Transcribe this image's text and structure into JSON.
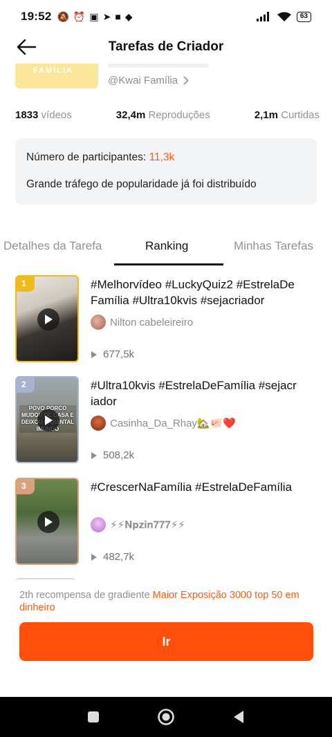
{
  "status_bar": {
    "time": "19:52",
    "battery": "63"
  },
  "header": {
    "title": "Tarefas de Criador"
  },
  "topic": {
    "thumb_text": "FAMÍLIA",
    "handle": "@Kwai Família"
  },
  "stats": {
    "videos_value": "1833",
    "videos_label": "vídeos",
    "plays_value": "32,4m",
    "plays_label": "Reproduções",
    "likes_value": "2,1m",
    "likes_label": "Curtidas"
  },
  "info": {
    "participants_label": "Número de participantes:",
    "participants_value": "11,3k",
    "traffic_text": "Grande tráfego de popularidade já foi distribuído"
  },
  "tabs": [
    {
      "label": "Detalhes da Tarefa",
      "active": false
    },
    {
      "label": "Ranking",
      "active": true
    },
    {
      "label": "Minhas Tarefas",
      "active": false
    }
  ],
  "ranking": [
    {
      "rank": "1",
      "title": "#Melhorvídeo #LuckyQuiz2 #EstrelaDe Família #Ultra10kvis #sejacriador",
      "author": "Nilton cabeleireiro",
      "views": "677,5k"
    },
    {
      "rank": "2",
      "title": "#Ultra10kvis #EstrelaDeFamília #sejacr iador",
      "author": "Casinha_Da_Rhay🏡🐖❤️",
      "views": "508,2k"
    },
    {
      "rank": "3",
      "title": "#CrescerNaFamília #EstrelaDeFamília",
      "author": "⚡⚡𝐍𝐩𝐳𝐢𝐧𝟕𝟕𝟕⚡⚡",
      "views": "482,7k"
    }
  ],
  "thumb2_caption": "POVO PORCO MUDOU DE CASA E DEIXOU O QUINTAL IMUNDO",
  "reward": {
    "prefix": "2th recompensa de gradiente",
    "highlight": "Maior Exposição 3000 top 50 em dinheiro"
  },
  "action": {
    "go_label": "Ir"
  },
  "colors": {
    "accent": "#ff4f0a",
    "highlight": "#ff5a14"
  }
}
